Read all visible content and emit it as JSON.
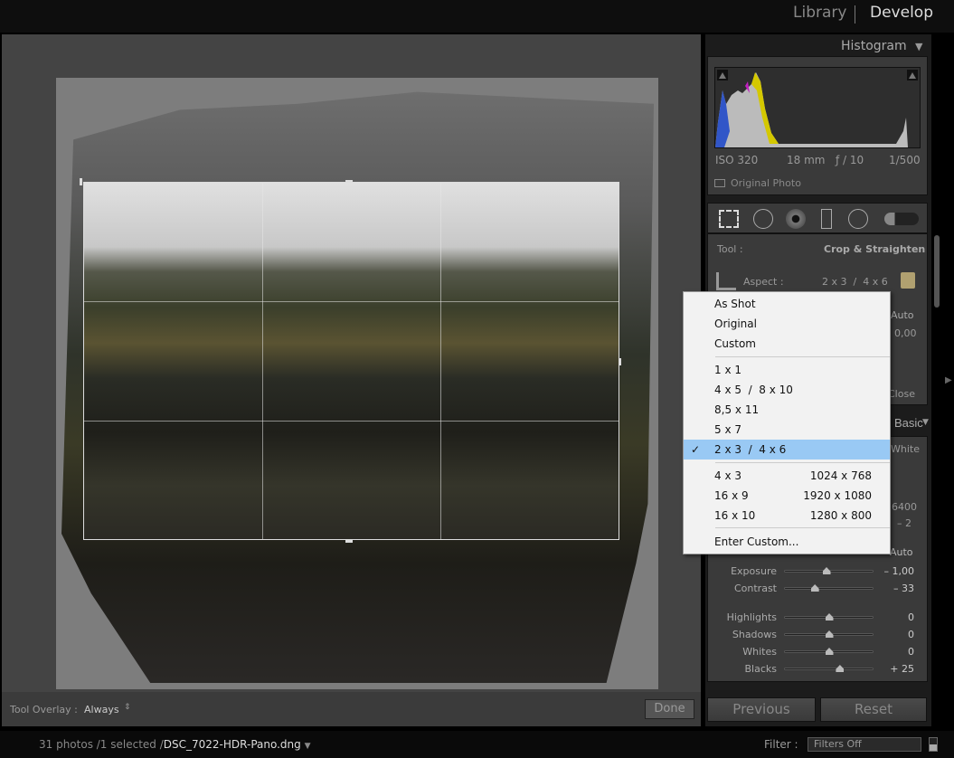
{
  "modules": {
    "library": "Library",
    "develop": "Develop"
  },
  "histogram": {
    "title": "Histogram",
    "iso": "ISO 320",
    "focal": "18 mm",
    "aperture": "ƒ / 10",
    "shutter": "1/500",
    "original_photo": "Original Photo"
  },
  "crop": {
    "tool_label": "Tool :",
    "tool_value": "Crop & Straighten",
    "aspect_label": "Aspect :",
    "aspect_value": "2 x 3  /  4 x 6",
    "hidden_auto": "Auto",
    "hidden_angle": "0,00",
    "close": "Close"
  },
  "basic": {
    "title": "Basic",
    "wb_value": "White",
    "temp": "6400",
    "tint": "– 2",
    "tone_auto": "Auto",
    "sliders": [
      {
        "label": "Exposure",
        "value": "– 1,00",
        "pos": 0.47
      },
      {
        "label": "Contrast",
        "value": "– 33",
        "pos": 0.34
      },
      {
        "label": "Highlights",
        "value": "0",
        "pos": 0.5
      },
      {
        "label": "Shadows",
        "value": "0",
        "pos": 0.5
      },
      {
        "label": "Whites",
        "value": "0",
        "pos": 0.5
      },
      {
        "label": "Blacks",
        "value": "+ 25",
        "pos": 0.62
      }
    ]
  },
  "buttons": {
    "previous": "Previous",
    "reset": "Reset",
    "done": "Done"
  },
  "toolbar": {
    "overlay_label": "Tool Overlay :",
    "overlay_value": "Always"
  },
  "status": {
    "prefix": "31 photos /1 selected /",
    "file": "DSC_7022-HDR-Pano.dng",
    "filter_label": "Filter :",
    "filter_value": "Filters Off"
  },
  "menu": {
    "items": [
      {
        "label": "As Shot"
      },
      {
        "label": "Original"
      },
      {
        "label": "Custom"
      },
      {
        "label": "1 x 1"
      },
      {
        "label": "4 x 5  /  8 x 10"
      },
      {
        "label": "8,5 x 11"
      },
      {
        "label": "5 x 7"
      },
      {
        "label": "2 x 3  /  4 x 6",
        "checked": true
      },
      {
        "label": "4 x 3",
        "res": "1024 x 768"
      },
      {
        "label": "16 x 9",
        "res": "1920 x 1080"
      },
      {
        "label": "16 x 10",
        "res": "1280 x 800"
      },
      {
        "label": "Enter Custom..."
      }
    ],
    "check": "✓"
  }
}
